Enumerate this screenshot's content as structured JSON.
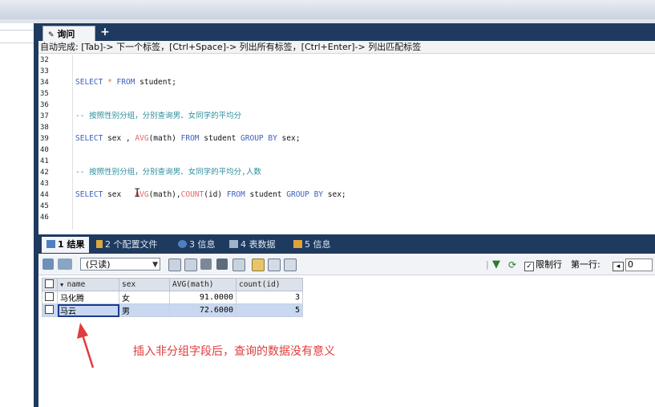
{
  "tabs": {
    "query_label": "询问",
    "add_label": "+"
  },
  "hint_text": "自动完成: [Tab]-> 下一个标签，[Ctrl+Space]-> 列出所有标签，[Ctrl+Enter]-> 列出匹配标签",
  "editor": {
    "line_numbers": [
      "32",
      "33",
      "34",
      "35",
      "36",
      "37",
      "38",
      "39",
      "40",
      "41",
      "42",
      "43",
      "44",
      "45",
      "46"
    ],
    "line34": {
      "select": "SELECT",
      "star": "*",
      "from": "FROM",
      "rest": "student;"
    },
    "line37": "-- 按照性别分组，分别查询男、女同学的平均分",
    "line39": {
      "select": "SELECT",
      "cols": "sex ,",
      "avg": "AVG",
      "avg_arg": "(math)",
      "from": "FROM",
      "table": "student",
      "groupby": "GROUP BY",
      "rest": "sex;"
    },
    "line42": "-- 按照性别分组，分别查询男、女同学的平均分,人数",
    "line44": {
      "select": "SELECT",
      "cols": "sex",
      "avg": "AVG",
      "avg_arg": "(math),",
      "count": "COUNT",
      "count_arg": "(id)",
      "from": "FROM",
      "table": "student",
      "groupby": "GROUP BY",
      "rest": "sex;"
    }
  },
  "result_tabs": [
    {
      "label": "1 结果"
    },
    {
      "label": "2 个配置文件"
    },
    {
      "label": "3 信息"
    },
    {
      "label": "4 表数据"
    },
    {
      "label": "5 信息"
    }
  ],
  "toolbar": {
    "readonly_label": "(只读)",
    "limit_label": "限制行",
    "first_row_label": "第一行:",
    "first_row_value": "0"
  },
  "table": {
    "columns": [
      "name",
      "sex",
      "AVG(math)",
      "count(id)"
    ],
    "rows": [
      {
        "name": "马化腾",
        "sex": "女",
        "avg": "91.0000",
        "count": "3"
      },
      {
        "name": "马云",
        "sex": "男",
        "avg": "72.6000",
        "count": "5"
      }
    ]
  },
  "annotation": "插入非分组字段后，查询的数据没有意义",
  "colors": {
    "navy": "#1f3a5f",
    "keyword": "#3d5fc2",
    "function": "#e06a6a",
    "comment": "#2d8e9b",
    "annotation": "#e23b3b"
  }
}
